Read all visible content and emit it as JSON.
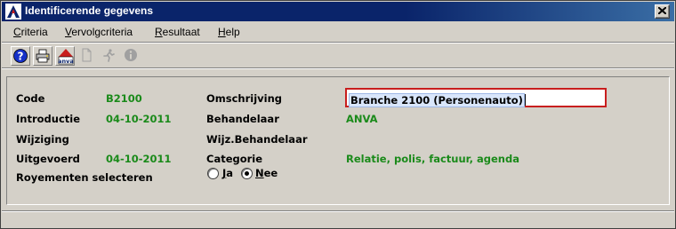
{
  "window": {
    "title": "Identificerende gegevens",
    "close_symbol": "X"
  },
  "menu": [
    {
      "u": "C",
      "rest": "riteria"
    },
    {
      "u": "V",
      "rest": "ervolgcriteria"
    },
    {
      "u": "R",
      "rest": "esultaat"
    },
    {
      "u": "H",
      "rest": "elp"
    }
  ],
  "toolbar": {
    "icons": [
      "help-icon",
      "print-icon",
      "anva-logo-icon",
      "document-icon",
      "runner-icon",
      "info-icon"
    ],
    "anva_text": "anva"
  },
  "form": {
    "code_label": "Code",
    "code_value": "B2100",
    "introductie_label": "Introductie",
    "introductie_value": "04-10-2011",
    "wijziging_label": "Wijziging",
    "uitgevoerd_label": "Uitgevoerd",
    "uitgevoerd_value": "04-10-2011",
    "royementen_label": "Royementen selecteren",
    "omschrijving_label": "Omschrijving",
    "omschrijving_value": "Branche 2100 (Personenauto)",
    "behandelaar_label": "Behandelaar",
    "behandelaar_value": "ANVA",
    "wijz_behandelaar_label": "Wijz.Behandelaar",
    "categorie_label": "Categorie",
    "categorie_value": "Relatie, polis, factuur, agenda",
    "radio_ja_u": "J",
    "radio_ja_rest": "a",
    "radio_nee_u": "N",
    "radio_nee_rest": "ee",
    "selected": "Nee"
  },
  "colors": {
    "value_green": "#1a8a1a",
    "title_bar": "#0a246a",
    "focus_border": "#c81e1e"
  }
}
